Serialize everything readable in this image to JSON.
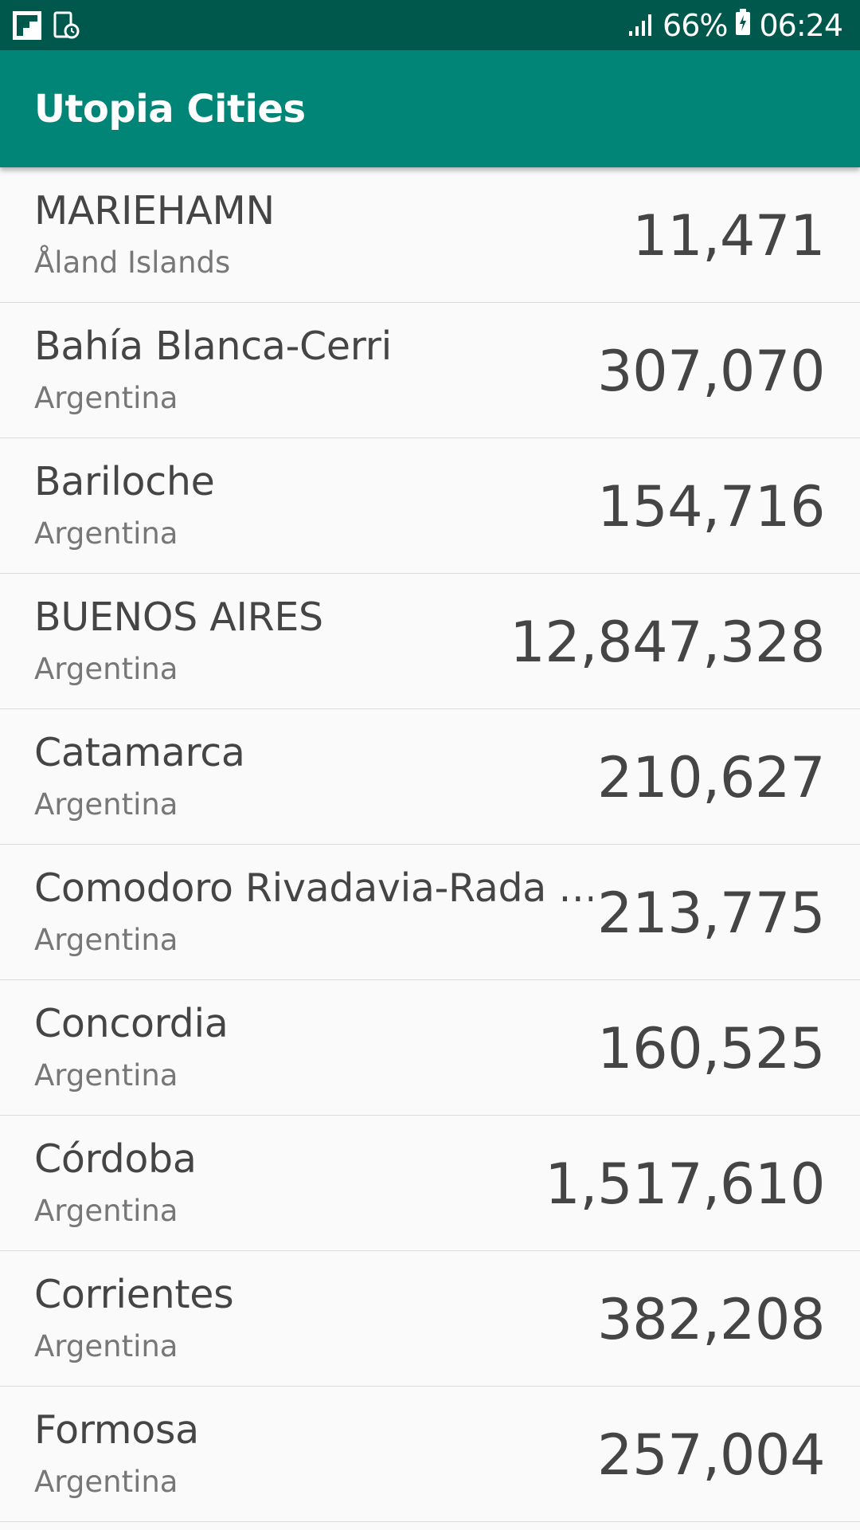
{
  "status_bar": {
    "battery": "66%",
    "time": "06:24",
    "icons": [
      "flipboard-icon",
      "screenshot-icon",
      "signal-icon",
      "battery-icon"
    ]
  },
  "app_bar": {
    "title": "Utopia Cities"
  },
  "cities": [
    {
      "name": "MARIEHAMN",
      "country": "Åland Islands",
      "population": "11,471"
    },
    {
      "name": "Bahía Blanca-Cerri",
      "country": "Argentina",
      "population": "307,070"
    },
    {
      "name": "Bariloche",
      "country": "Argentina",
      "population": "154,716"
    },
    {
      "name": "BUENOS AIRES",
      "country": "Argentina",
      "population": "12,847,328"
    },
    {
      "name": "Catamarca",
      "country": "Argentina",
      "population": "210,627"
    },
    {
      "name": "Comodoro Rivadavia-Rada Tilly",
      "country": "Argentina",
      "population": "213,775"
    },
    {
      "name": "Concordia",
      "country": "Argentina",
      "population": "160,525"
    },
    {
      "name": "Córdoba",
      "country": "Argentina",
      "population": "1,517,610"
    },
    {
      "name": "Corrientes",
      "country": "Argentina",
      "population": "382,208"
    },
    {
      "name": "Formosa",
      "country": "Argentina",
      "population": "257,004"
    }
  ],
  "colors": {
    "status_bar": "#00574b",
    "app_bar": "#008577",
    "background": "#fafafa",
    "primary_text": "#454545",
    "secondary_text": "#777777"
  }
}
